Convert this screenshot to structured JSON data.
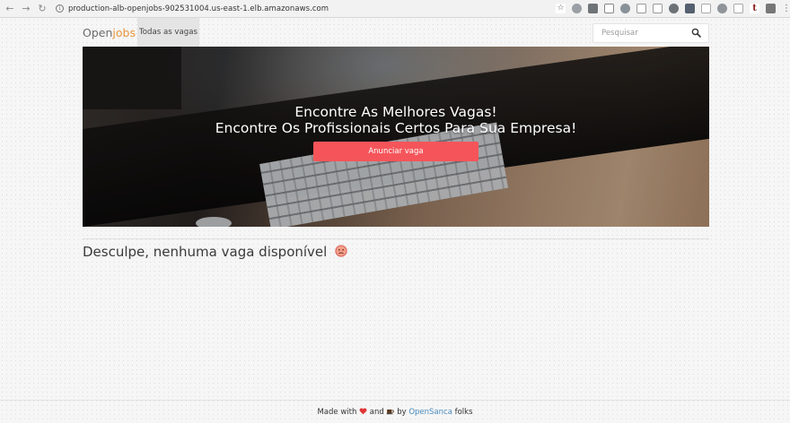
{
  "browser": {
    "url": "production-alb-openjobs-902531004.us-east-1.elb.amazonaws.com"
  },
  "nav": {
    "brand_open": "Open",
    "brand_jobs": "jobs",
    "tab_all_jobs": "Todas as vagas",
    "search_placeholder": "Pesquisar"
  },
  "hero": {
    "line1": "Encontre As Melhores Vagas!",
    "line2": "Encontre Os Profissionais Certos Para Sua Empresa!",
    "button": "Anunciar vaga"
  },
  "main": {
    "empty_message": "Desculpe, nenhuma vaga disponível"
  },
  "footer": {
    "made_with": "Made with",
    "and": "and",
    "by": "by",
    "org": "OpenSanca",
    "folks": "folks"
  },
  "colors": {
    "brand_accent": "#e8963c",
    "cta": "#f5555a",
    "link": "#4a8bbd"
  }
}
